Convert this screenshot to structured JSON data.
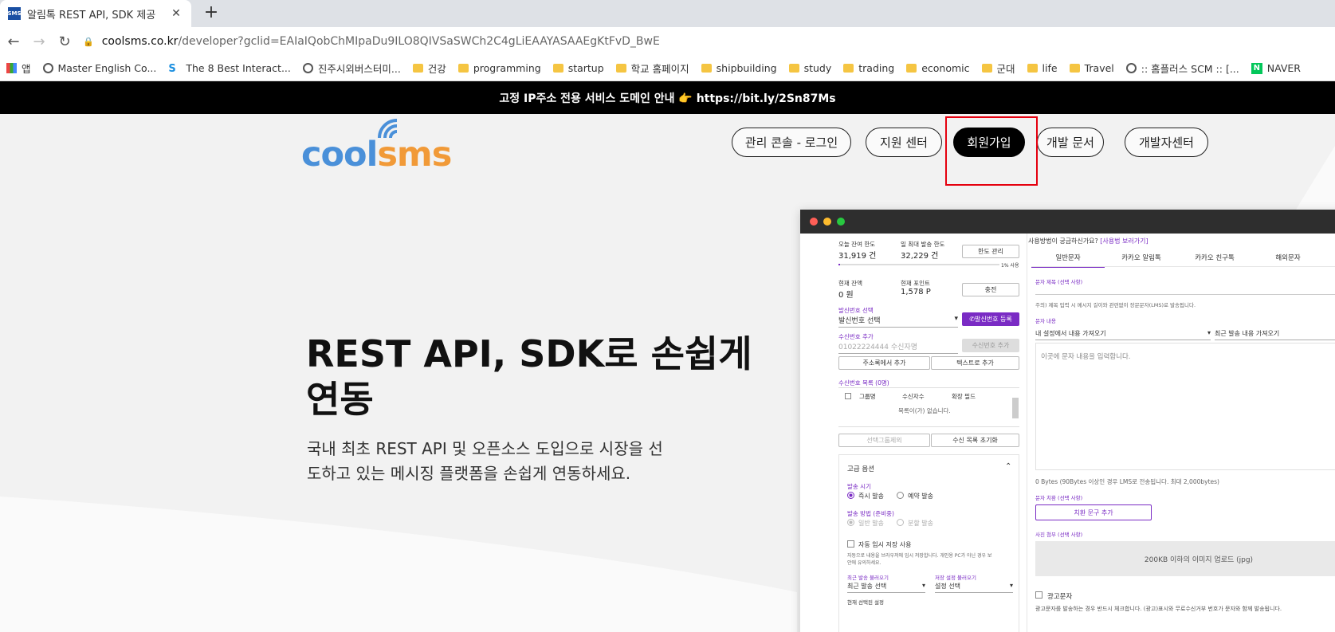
{
  "browser": {
    "tab_title": "알림톡 REST API, SDK 제공",
    "favicon_text": "SMS",
    "url_host": "coolsms.co.kr",
    "url_path": "/developer?gclid=EAIaIQobChMIpaDu9ILO8QIVSaSWCh2C4gLiEAAYASAAEgKtFvD_BwE",
    "bookmarks": [
      {
        "label": "앱",
        "icon": "apps-icon"
      },
      {
        "label": "Master English Co...",
        "icon": "globe-icon"
      },
      {
        "label": "The 8 Best Interact...",
        "icon": "s-icon"
      },
      {
        "label": "진주시외버스터미...",
        "icon": "globe-icon"
      },
      {
        "label": "건강",
        "icon": "folder-icon"
      },
      {
        "label": "programming",
        "icon": "folder-icon"
      },
      {
        "label": "startup",
        "icon": "folder-icon"
      },
      {
        "label": "학교 홈페이지",
        "icon": "folder-icon"
      },
      {
        "label": "shipbuilding",
        "icon": "folder-icon"
      },
      {
        "label": "study",
        "icon": "folder-icon"
      },
      {
        "label": "trading",
        "icon": "folder-icon"
      },
      {
        "label": "economic",
        "icon": "folder-icon"
      },
      {
        "label": "군대",
        "icon": "folder-icon"
      },
      {
        "label": "life",
        "icon": "folder-icon"
      },
      {
        "label": "Travel",
        "icon": "folder-icon"
      },
      {
        "label": ":: 홈플러스 SCM :: [...",
        "icon": "globe-icon"
      },
      {
        "label": "NAVER",
        "icon": "naver-icon"
      }
    ]
  },
  "banner": {
    "text": "고정 IP주소 전용 서비스 도메인 안내 👉 https://bit.ly/2Sn87Ms"
  },
  "logo": {
    "cool": "cool",
    "sms": "sms"
  },
  "nav": {
    "console": "관리 콘솔 - 로그인",
    "support": "지원 센터",
    "signup": "회원가입",
    "docs": "개발 문서",
    "devcenter": "개발자센터"
  },
  "hero": {
    "title_line1": "REST API, SDK로 손쉽게",
    "title_line2": "연동",
    "desc_line1": "국내 최초 REST API 및 오픈소스 도입으로 시장을 선",
    "desc_line2": "도하고 있는 메시징 플랫폼을 손쉽게 연동하세요."
  },
  "mock": {
    "today_limit_label": "오늘 잔여 한도",
    "today_limit_value": "31,919 건",
    "daily_max_label": "일 최대 발송 한도",
    "daily_max_value": "32,229 건",
    "limit_btn": "한도 관리",
    "usage_pct": "1% 사용",
    "usage_fraction": 0.01,
    "balance_label": "현재 잔액",
    "balance_value": "0 원",
    "points_label": "현재 포인트",
    "points_value": "1,578 P",
    "charge_btn": "충전",
    "sender_label": "발신번호 선택",
    "sender_select": "발신번호 선택",
    "sender_register_btn": "발신번호 등록",
    "recipient_add_label": "수신번호 추가",
    "recipient_placeholder": "01022224444 수신자명",
    "recipient_add_btn": "수신번호 추가",
    "addressbook_btn": "주소록에서 추가",
    "text_add_btn": "텍스트로 추가",
    "recipient_list_label": "수신번호 목록 (0명)",
    "col_group": "그룹명",
    "col_count": "수신자수",
    "col_ext": "확장 필드",
    "empty_list": "목록이(가) 없습니다.",
    "delete_selected_btn": "선택그룹제외",
    "reset_list_btn": "수신 목록 초기화",
    "advanced_label": "고급 옵션",
    "send_time_label": "발송 시기",
    "send_now": "즉시 발송",
    "send_reserve": "예약 발송",
    "send_method_label": "발송 방법 (준비중)",
    "method_normal": "일반 발송",
    "method_split": "분할 발송",
    "autosave_label": "자동 임시 저장 사용",
    "autosave_desc1": "자동으로 내용을 브라우저에 임시 저장합니다. 개인용 PC가 아닌 경우 보",
    "autosave_desc2": "안에 유의하세요.",
    "recent_label": "최근 발송 불러오기",
    "recent_select": "최근 발송 선택",
    "saved_label": "저장 설정 불러오기",
    "saved_select": "설정 선택",
    "current_label": "현재 선택된 설정",
    "help_text": "사용방법이 궁금하신가요?",
    "help_link": "[사용법 보러가기]",
    "tabs": [
      "일반문자",
      "카카오 알림톡",
      "카카오 친구톡",
      "해외문자"
    ],
    "subject_label": "문자 제목 (선택 사항)",
    "subject_note": "주의) 제목 입력 시 메시지 길이와 관련없이 장문문자(LMS)로 발송됩니다.",
    "content_label": "문자 내용",
    "load_mine": "내 설정에서 내용 가져오기",
    "load_recent": "최근 발송 내용 가져오기",
    "content_placeholder": "이곳에 문자 내용을 입력합니다.",
    "bytes_note": "0 Bytes (90Bytes 이상인 경우 LMS로 전송됩니다. 최대 2,000bytes)",
    "replace_label": "문자 치환 (선택 사항)",
    "replace_btn": "치환 문구 추가",
    "photo_label": "사진 첨부 (선택 사항)",
    "photo_upload": "200KB 이하의 이미지 업로드 (jpg)",
    "ad_label": "광고문자",
    "ad_note": "광고문자를 발송하는 경우 반드시 체크합니다. (광고)표시와 무료수신거부 번호가 문자와 함께 발송됩니다."
  },
  "colors": {
    "accent": "#7a2bc4",
    "logo_blue": "#4a90d9",
    "logo_orange": "#f19a38",
    "highlight": "#e5000f"
  }
}
